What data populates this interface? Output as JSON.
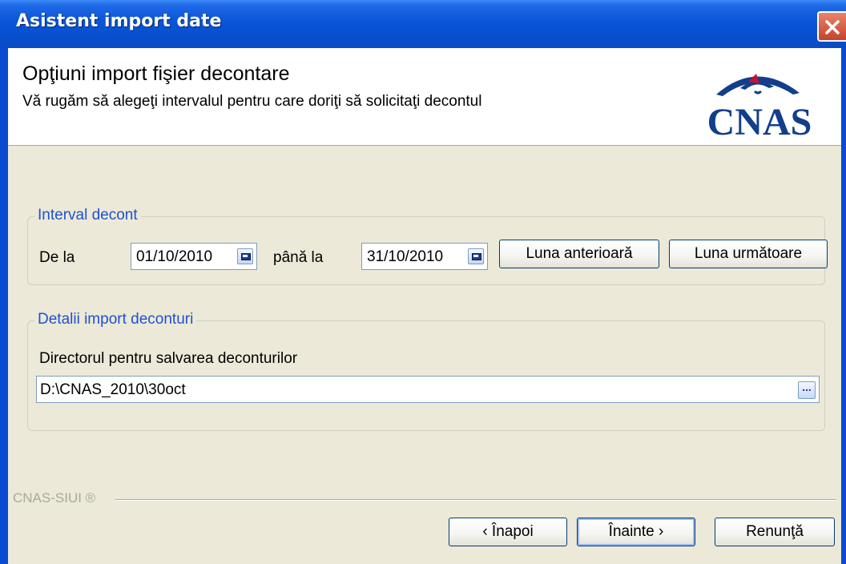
{
  "window": {
    "title": "Asistent import date"
  },
  "header": {
    "title": "Opţiuni import fişier decontare",
    "subtitle": "Vă rugăm să alegeţi intervalul pentru care doriţi să solicitaţi decontul",
    "logo_text": "CNAS"
  },
  "interval": {
    "legend": "Interval decont",
    "from_label": "De la",
    "from_value": "01/10/2010",
    "to_label": "până la",
    "to_value": "31/10/2010",
    "prev_month_button": "Luna anterioară",
    "next_month_button": "Luna următoare"
  },
  "details": {
    "legend": "Detalii import deconturi",
    "directory_label": "Directorul pentru salvarea deconturilor",
    "directory_value": "D:\\CNAS_2010\\30oct",
    "browse_button": "..."
  },
  "footer": {
    "brand": "CNAS-SIUI ®",
    "back_button": "‹ Înapoi",
    "next_button": "Înainte ›",
    "cancel_button": "Renunţă"
  },
  "colors": {
    "titlebar": "#0A55D8",
    "legend": "#1F51D0",
    "logo": "#123E8C",
    "logo_accent": "#C8102E"
  },
  "icons": {
    "close": "close-x-icon",
    "calendar": "calendar-icon",
    "browse": "ellipsis-icon"
  }
}
